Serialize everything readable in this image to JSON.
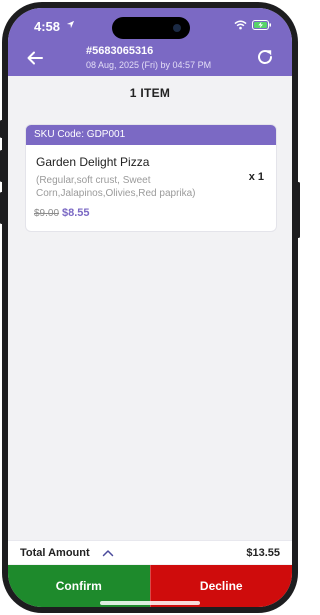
{
  "status_bar": {
    "time": "4:58",
    "icons": [
      "location-arrow-icon",
      "wifi-icon",
      "battery-charging-icon"
    ]
  },
  "header": {
    "order_number": "#5683065316",
    "order_datetime": "08 Aug, 2025 (Fri) by 04:57 PM",
    "back_icon": "back-arrow-icon",
    "refresh_icon": "refresh-icon"
  },
  "items_heading": "1 ITEM",
  "items": [
    {
      "sku_label": "SKU Code: GDP001",
      "name": "Garden Delight Pizza",
      "options": "(Regular,soft crust, Sweet Corn,Jalapinos,Olivies,Red paprika)",
      "quantity": "x 1",
      "original_price": "$9.00",
      "price": "$8.55"
    }
  ],
  "footer": {
    "total_label": "Total Amount",
    "total_value": "$13.55",
    "expand_icon": "chevron-up-icon",
    "confirm_label": "Confirm",
    "decline_label": "Decline"
  },
  "colors": {
    "header": "#7b69c4",
    "confirm": "#1e8a2c",
    "decline": "#cf0c0c",
    "price": "#7b69c4"
  }
}
